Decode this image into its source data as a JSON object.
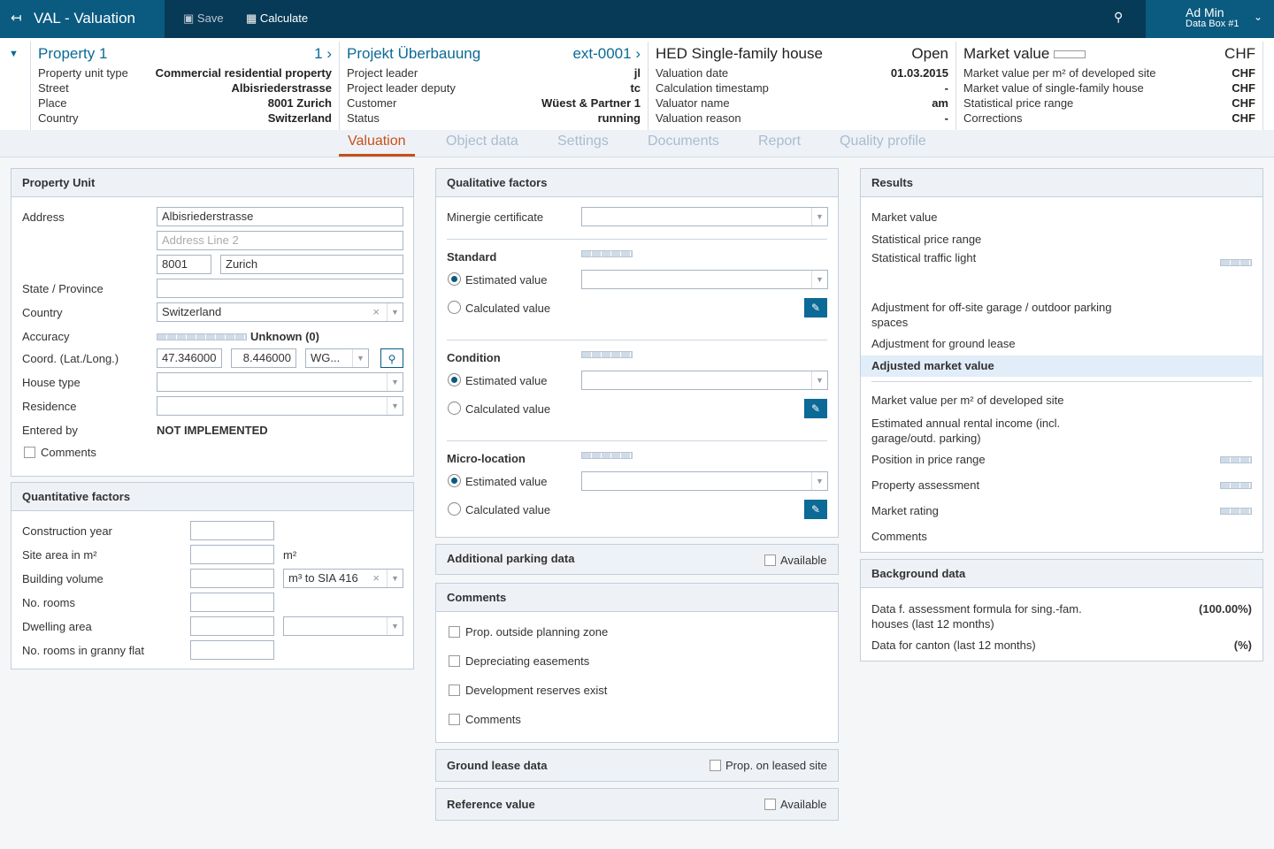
{
  "app": {
    "title": "VAL - Valuation",
    "save": "Save",
    "calculate": "Calculate",
    "user": "Ad Min",
    "databox": "Data Box #1"
  },
  "summary": {
    "property": {
      "title": "Property 1",
      "nav": "1",
      "rows": [
        [
          "Property unit type",
          "Commercial residential property"
        ],
        [
          "Street",
          "Albisriederstrasse"
        ],
        [
          "Place",
          "8001 Zurich"
        ],
        [
          "Country",
          "Switzerland"
        ]
      ]
    },
    "project": {
      "title": "Projekt Überbauung",
      "nav": "ext-0001",
      "rows": [
        [
          "Project leader",
          "jl"
        ],
        [
          "Project leader deputy",
          "tc"
        ],
        [
          "Customer",
          "Wüest & Partner 1"
        ],
        [
          "Status",
          "running"
        ]
      ]
    },
    "valuation": {
      "title": "HED Single-family house",
      "status": "Open",
      "rows": [
        [
          "Valuation date",
          "01.03.2015"
        ],
        [
          "Calculation timestamp",
          "-"
        ],
        [
          "Valuator name",
          "am"
        ],
        [
          "Valuation reason",
          "-"
        ]
      ]
    },
    "market": {
      "title": "Market value",
      "currency": "CHF",
      "rows": [
        [
          "Market value per m² of developed site",
          "CHF"
        ],
        [
          "Market value of single-family house",
          "CHF"
        ],
        [
          "Statistical price range",
          "CHF"
        ],
        [
          "Corrections",
          "CHF"
        ]
      ]
    }
  },
  "tabs": [
    "Valuation",
    "Object data",
    "Settings",
    "Documents",
    "Report",
    "Quality profile"
  ],
  "property_unit": {
    "title": "Property Unit",
    "address": "Address",
    "street": "Albisriederstrasse",
    "line2_ph": "Address Line 2",
    "zip": "8001",
    "city": "Zurich",
    "state": "State / Province",
    "country": "Country",
    "country_val": "Switzerland",
    "accuracy": "Accuracy",
    "accuracy_val": "Unknown (0)",
    "coord": "Coord. (Lat./Long.)",
    "lat": "47.346000",
    "lon": "8.446000",
    "sys": "WG...",
    "house_type": "House type",
    "residence": "Residence",
    "entered_by": "Entered by",
    "entered_val": "NOT IMPLEMENTED",
    "comments": "Comments"
  },
  "quant": {
    "title": "Quantitative factors",
    "construction": "Construction year",
    "site": "Site area in m²",
    "site_unit": "m²",
    "volume": "Building volume",
    "volume_unit": "m³ to SIA 416",
    "rooms": "No. rooms",
    "dwelling": "Dwelling area",
    "granny": "No. rooms in granny flat"
  },
  "qual": {
    "title": "Qualitative factors",
    "minergie": "Minergie certificate",
    "estimated": "Estimated value",
    "calculated": "Calculated value",
    "groups": [
      "Standard",
      "Condition",
      "Micro-location"
    ]
  },
  "parking": {
    "title": "Additional parking data",
    "available": "Available"
  },
  "comments": {
    "title": "Comments",
    "items": [
      "Prop. outside planning zone",
      "Depreciating easements",
      "Development reserves exist",
      "Comments"
    ]
  },
  "ground": {
    "title": "Ground lease data",
    "check": "Prop. on leased site"
  },
  "reference": {
    "title": "Reference value",
    "available": "Available"
  },
  "results": {
    "title": "Results",
    "market_value": "Market value",
    "price_range": "Statistical price range",
    "traffic": "Statistical traffic light",
    "adj_garage": "Adjustment for off-site garage / outdoor parking spaces",
    "adj_ground": "Adjustment for ground lease",
    "adjusted": "Adjusted market value",
    "per_m2": "Market value per m² of developed site",
    "rental": "Estimated annual rental income (incl. garage/outd. parking)",
    "position": "Position in price range",
    "assessment": "Property assessment",
    "rating": "Market rating",
    "comments": "Comments"
  },
  "background": {
    "title": "Background data",
    "formula": "Data f. assessment formula for sing.-fam. houses (last 12 months)",
    "formula_val": "(100.00%)",
    "canton": "Data for canton (last 12 months)",
    "canton_val": "(%)"
  }
}
